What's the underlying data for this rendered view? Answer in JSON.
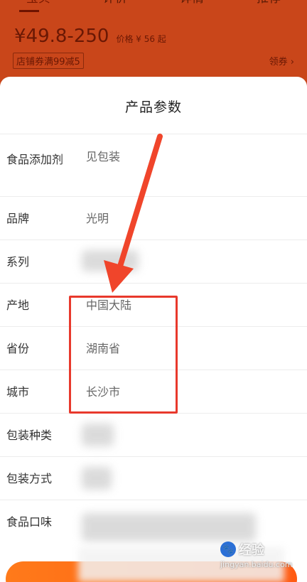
{
  "background": {
    "tabs": [
      "宝贝",
      "评价",
      "详情",
      "推荐"
    ],
    "price": "¥49.8-250",
    "price_sub": "价格 ¥ 56 起",
    "coupon": "店铺券满99减5",
    "coupon_action": "领券 ›"
  },
  "sheet": {
    "title": "产品参数",
    "rows": [
      {
        "label": "食品添加剂",
        "value": "见包装"
      },
      {
        "label": "品牌",
        "value": "光明"
      },
      {
        "label": "系列",
        "value": ""
      },
      {
        "label": "产地",
        "value": "中国大陆"
      },
      {
        "label": "省份",
        "value": "湖南省"
      },
      {
        "label": "城市",
        "value": "长沙市"
      },
      {
        "label": "包装种类",
        "value": ""
      },
      {
        "label": "包装方式",
        "value": ""
      },
      {
        "label": "食品口味",
        "value": ""
      }
    ]
  },
  "watermark": {
    "brand": "经验",
    "url": "jingyan.baidu.com"
  },
  "colors": {
    "accent": "#e8392c",
    "button": "#ff6a16"
  }
}
